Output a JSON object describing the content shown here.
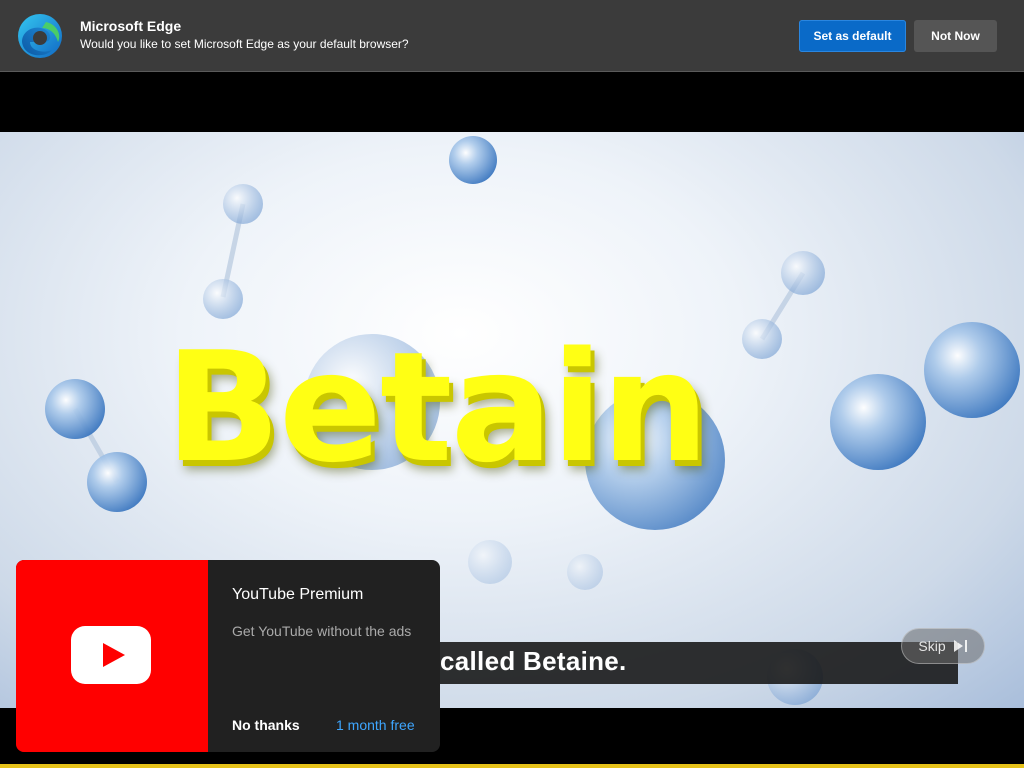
{
  "edge_banner": {
    "app_name": "Microsoft Edge",
    "message": "Would you like to set Microsoft Edge as your default browser?",
    "primary_button": "Set as default",
    "secondary_button": "Not Now",
    "icon": "edge-logo-icon",
    "colors": {
      "background": "#3b3b3b",
      "primary": "#0a6ac8",
      "secondary": "#555555"
    }
  },
  "video": {
    "title_text": "Betain",
    "caption": "called Betaine.",
    "skip_label": "Skip",
    "skip_icon": "skip-next-icon"
  },
  "premium_card": {
    "title": "YouTube Premium",
    "description": "Get YouTube without the ads",
    "dismiss_label": "No thanks",
    "cta_label": "1 month free",
    "icon": "youtube-logo-icon",
    "colors": {
      "accent": "#ff0000",
      "cta": "#3ea6ff",
      "background": "#212121"
    }
  }
}
